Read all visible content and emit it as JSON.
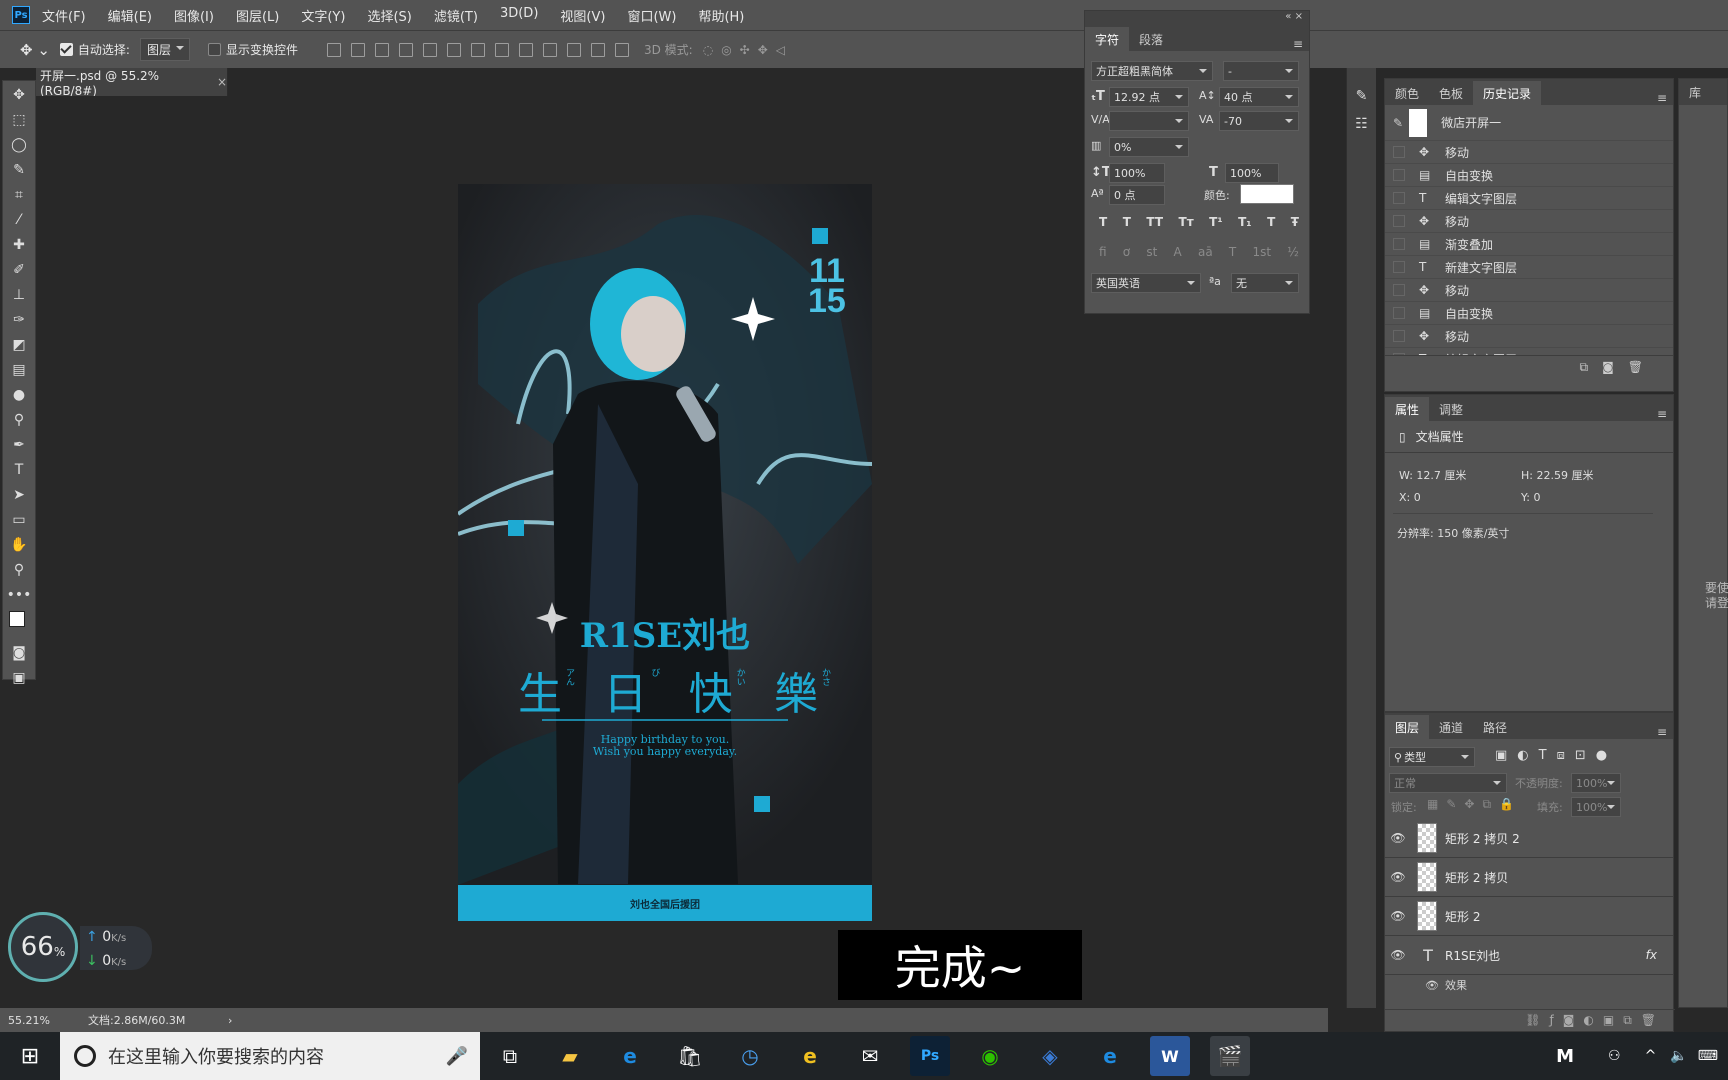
{
  "app": {
    "logo": "Ps"
  },
  "menu": [
    "文件(F)",
    "编辑(E)",
    "图像(I)",
    "图层(L)",
    "文字(Y)",
    "选择(S)",
    "滤镜(T)",
    "3D(D)",
    "视图(V)",
    "窗口(W)",
    "帮助(H)"
  ],
  "options": {
    "auto_select_label": "自动选择:",
    "auto_select_value": "图层",
    "show_transform_label": "显示变换控件",
    "mode3d_label": "3D 模式:"
  },
  "document": {
    "tab_title": "开屏一.psd @ 55.2%(RGB/8#)",
    "close": "×"
  },
  "poster": {
    "date_top": "11",
    "date_bottom": "15",
    "title_line1": "R1SE刘也",
    "title_line2_chars": [
      "生",
      "日",
      "快",
      "樂"
    ],
    "title_line2_small": [
      "アん",
      "び",
      "かい",
      "かさ"
    ],
    "sub_line1": "Happy birthday to you.",
    "sub_line2": "Wish you happy everyday.",
    "band_text": "刘也全国后援团",
    "accent": "#1eaad3"
  },
  "char_panel": {
    "tabs": [
      "字符",
      "段落"
    ],
    "font_family": "方正超粗黑简体",
    "font_style": "-",
    "font_size": "12.92 点",
    "leading": "40 点",
    "kerning": "",
    "tracking": "-70",
    "scale_pct": "0%",
    "v_scale": "100%",
    "h_scale": "100%",
    "baseline": "0 点",
    "color_label": "颜色:",
    "style_buttons": [
      "T",
      "T",
      "TT",
      "Tт",
      "T¹",
      "T₁",
      "T",
      "Ŧ"
    ],
    "ot_buttons": [
      "fi",
      "ơ",
      "st",
      "A",
      "aā",
      "T",
      "1st",
      "½"
    ],
    "language": "英国英语",
    "aa_label": "ªa",
    "aa_value": "无"
  },
  "history_panel": {
    "tabs": [
      "颜色",
      "色板",
      "历史记录"
    ],
    "snapshot": "微店开屏一",
    "items": [
      "移动",
      "自由变换",
      "编辑文字图层",
      "移动",
      "渐变叠加",
      "新建文字图层",
      "移动",
      "自由变换",
      "移动",
      "编辑文字图层"
    ],
    "library_tab": "库"
  },
  "properties_panel": {
    "tabs": [
      "属性",
      "调整"
    ],
    "section": "文档属性",
    "w": "W:  12.7 厘米",
    "h": "H:  22.59 厘米",
    "x": "X:  0",
    "y": "Y:  0",
    "resolution": "分辨率: 150 像素/英寸"
  },
  "layers_panel": {
    "tabs": [
      "图层",
      "通道",
      "路径"
    ],
    "filter": "类型",
    "blend": "正常",
    "opacity_label": "不透明度:",
    "opacity": "100%",
    "lock_label": "锁定:",
    "fill_label": "填充:",
    "fill": "100%",
    "layers": [
      "矩形 2 拷贝 2",
      "矩形 2 拷贝",
      "矩形 2"
    ],
    "text_layer": "R1SE刘也",
    "fx": "fx",
    "effects": "效果"
  },
  "lib_side": {
    "line1": "要使",
    "line2": "请登"
  },
  "overlay": {
    "caption": "完成~"
  },
  "netmon": {
    "percent": "66",
    "pct_sign": "%",
    "up": "0",
    "down": "0",
    "unit": "K/s"
  },
  "status": {
    "zoom": "55.21%",
    "doc": "文档:2.86M/60.3M"
  },
  "taskbar": {
    "search_placeholder": "在这里输入你要搜索的内容",
    "right_icon": "M"
  }
}
